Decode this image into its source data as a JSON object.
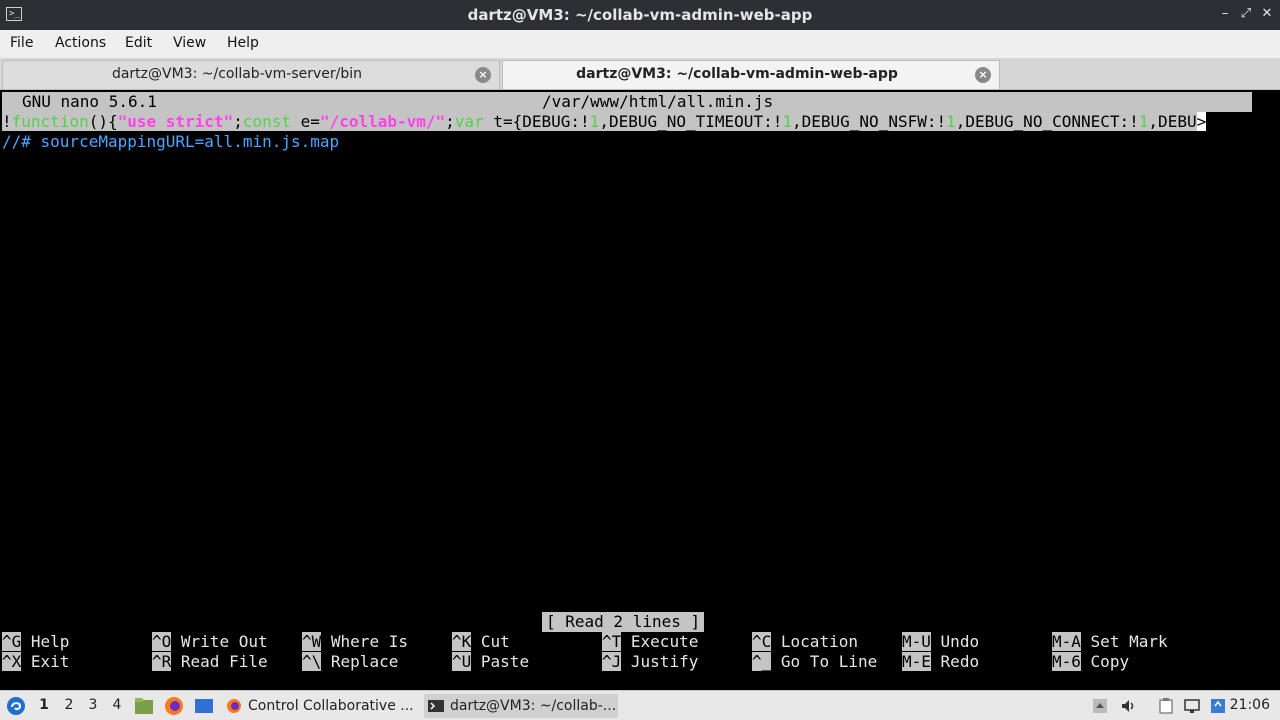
{
  "window": {
    "title": "dartz@VM3: ~/collab-vm-admin-web-app",
    "app_icon_text": ">_",
    "buttons": {
      "minimize": "–",
      "maximize": "⤢",
      "close": "✕"
    }
  },
  "menubar": {
    "items": [
      "File",
      "Actions",
      "Edit",
      "View",
      "Help"
    ]
  },
  "tabs": [
    {
      "label": "dartz@VM3: ~/collab-vm-server/bin",
      "active": false
    },
    {
      "label": "dartz@VM3: ~/collab-vm-admin-web-app",
      "active": true
    }
  ],
  "nano": {
    "version": "GNU nano 5.6.1",
    "filename": "/var/www/html/all.min.js",
    "line1": {
      "excl": "!",
      "kw_function": "function",
      "paren": "(){",
      "use_strict": "\"use strict\"",
      "semi1": ";",
      "kw_const": "const",
      "e_eq": " e=",
      "path_str": "\"/collab-vm/\"",
      "semi2": ";",
      "kw_var": "var",
      "rest_a": " t={DEBUG:!",
      "one1": "1",
      "rest_b": ",DEBUG_NO_TIMEOUT:!",
      "one2": "1",
      "rest_c": ",DEBUG_NO_NSFW:!",
      "one3": "1",
      "rest_d": ",DEBUG_NO_CONNECT:!",
      "one4": "1",
      "rest_e": ",DEBU",
      "more": ">"
    },
    "line2": "//# sourceMappingURL=all.min.js.map",
    "status": "[ Read 2 lines ]",
    "shortcuts": [
      {
        "key": "^G",
        "label": "Help"
      },
      {
        "key": "^O",
        "label": "Write Out"
      },
      {
        "key": "^W",
        "label": "Where Is"
      },
      {
        "key": "^K",
        "label": "Cut"
      },
      {
        "key": "^T",
        "label": "Execute"
      },
      {
        "key": "^C",
        "label": "Location"
      },
      {
        "key": "M-U",
        "label": "Undo"
      },
      {
        "key": "M-A",
        "label": "Set Mark"
      },
      {
        "key": "^X",
        "label": "Exit"
      },
      {
        "key": "^R",
        "label": "Read File"
      },
      {
        "key": "^\\",
        "label": "Replace"
      },
      {
        "key": "^U",
        "label": "Paste"
      },
      {
        "key": "^J",
        "label": "Justify"
      },
      {
        "key": "^_",
        "label": "Go To Line"
      },
      {
        "key": "M-E",
        "label": "Redo"
      },
      {
        "key": "M-6",
        "label": "Copy"
      }
    ]
  },
  "panel": {
    "desktops": [
      "1",
      "2",
      "3",
      "4"
    ],
    "tasks": [
      {
        "label": "Control Collaborative ...",
        "icon": "firefox-icon"
      },
      {
        "label": "dartz@VM3: ~/collab-...",
        "icon": "terminal-icon"
      }
    ],
    "clock": "21:06"
  },
  "colors": {
    "titlebar": "#2c2f33",
    "menubar": "#efefef",
    "terminal_bg": "#000000",
    "nano_bar": "#c4c4c4",
    "syntax_keyword": "#55d04a",
    "syntax_string": "#ff43e8",
    "syntax_comment": "#4aa6ff"
  }
}
